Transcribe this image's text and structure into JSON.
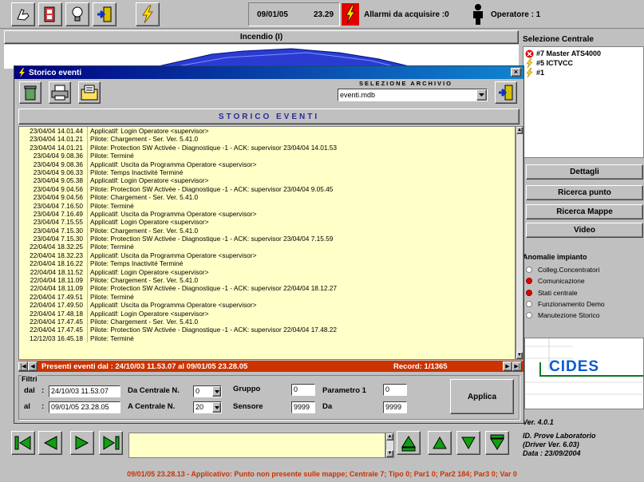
{
  "toolbar": {
    "date": "09/01/05",
    "time": "23.29",
    "alarms": "Allarmi da acquisire :0",
    "operator": "Operatore : 1"
  },
  "alarm_bar": {
    "title": "Incendio (I)"
  },
  "central_panel": {
    "title": "Selezione Centrale",
    "items": [
      {
        "label": "#7 Master ATS4000",
        "icon": "error-x-icon"
      },
      {
        "label": "#5 ICTVCC",
        "icon": "lightning-icon"
      },
      {
        "label": "#1",
        "icon": "lightning-icon"
      }
    ]
  },
  "right_buttons": [
    "Dettagli",
    "Ricerca punto",
    "Ricerca Mappe",
    "Video"
  ],
  "anomalies": {
    "title": "Anomalie impianto",
    "items": [
      {
        "label": "Colleg.Concentratori",
        "active": false
      },
      {
        "label": "Comunicazione",
        "active": true
      },
      {
        "label": "Stati centrale",
        "active": true
      },
      {
        "label": "Funzionamento Demo",
        "active": false
      },
      {
        "label": "Manutezione Storico",
        "active": false
      }
    ]
  },
  "logo": "CIDES",
  "version": {
    "ver": "Ver. 4.0.1",
    "line1": "ID. Prove Laboratorio",
    "line2": "(Driver Ver. 6.03)",
    "line3": "Data : 23/09/2004"
  },
  "dialog": {
    "title": "Storico eventi",
    "archive_label": "SELEZIONE ARCHIVIO",
    "archive_value": "eventi.mdb",
    "header": "STORICO EVENTI",
    "entries": [
      {
        "ts": "23/04/04 14.01.44",
        "msg": "Applicatif:  Login Operatore <supervisor>"
      },
      {
        "ts": "23/04/04 14.01.21",
        "msg": "Pilote: Chargement   - Ser.  Ver. 5.41.0"
      },
      {
        "ts": "23/04/04 14.01.21",
        "msg": "Pilote: Protection SW Activée   - Diagnostique -1 - ACK: supervisor 23/04/04 14.01.53"
      },
      {
        "ts": "23/04/04 9.08.36",
        "msg": "Pilote: Terminé"
      },
      {
        "ts": "23/04/04 9.08.36",
        "msg": "Applicatif:  Uscita da Programma Operatore <supervisor>"
      },
      {
        "ts": "23/04/04 9.06.33",
        "msg": "Pilote: Temps Inactivité Terminé"
      },
      {
        "ts": "23/04/04 9.05.38",
        "msg": "Applicatif:  Login Operatore <supervisor>"
      },
      {
        "ts": "23/04/04 9.04.56",
        "msg": "Pilote: Protection SW Activée   - Diagnostique -1 - ACK: supervisor 23/04/04 9.05.45"
      },
      {
        "ts": "23/04/04 9.04.56",
        "msg": "Pilote: Chargement   - Ser.  Ver. 5.41.0"
      },
      {
        "ts": "23/04/04 7.16.50",
        "msg": "Pilote: Terminé"
      },
      {
        "ts": "23/04/04 7.16.49",
        "msg": "Applicatif:  Uscita da Programma Operatore <supervisor>"
      },
      {
        "ts": "23/04/04 7.15.55",
        "msg": "Applicatif:  Login Operatore <supervisor>"
      },
      {
        "ts": "23/04/04 7.15.30",
        "msg": "Pilote: Chargement   - Ser.  Ver. 5.41.0"
      },
      {
        "ts": "23/04/04 7.15.30",
        "msg": "Pilote: Protection SW Activée   - Diagnostique -1 - ACK: supervisor 23/04/04 7.15.59"
      },
      {
        "ts": "22/04/04 18.32.25",
        "msg": "Pilote: Terminé"
      },
      {
        "ts": "22/04/04 18.32.23",
        "msg": "Applicatif:  Uscita da Programma Operatore <supervisor>"
      },
      {
        "ts": "22/04/04 18.16.22",
        "msg": "Pilote: Temps Inactivité Terminé"
      },
      {
        "ts": "22/04/04 18.11.52",
        "msg": "Applicatif:  Login Operatore <supervisor>"
      },
      {
        "ts": "22/04/04 18.11.09",
        "msg": "Pilote: Chargement   - Ser.  Ver. 5.41.0"
      },
      {
        "ts": "22/04/04 18.11.09",
        "msg": "Pilote: Protection SW Activée   - Diagnostique -1 - ACK: supervisor 22/04/04 18.12.27"
      },
      {
        "ts": "22/04/04 17.49.51",
        "msg": "Pilote: Terminé"
      },
      {
        "ts": "22/04/04 17.49.50",
        "msg": "Applicatif:  Uscita da Programma Operatore <supervisor>"
      },
      {
        "ts": "22/04/04 17.48.18",
        "msg": "Applicatif:  Login Operatore <supervisor>"
      },
      {
        "ts": "22/04/04 17.47.45",
        "msg": "Pilote: Chargement   - Ser.  Ver. 5.41.0"
      },
      {
        "ts": "22/04/04 17.47.45",
        "msg": "Pilote: Protection SW Activée   - Diagnostique -1 - ACK: supervisor 22/04/04 17.48.22"
      },
      {
        "ts": "12/12/03 16.45.18",
        "msg": "Pilote: Terminé"
      }
    ],
    "status_events": "Presenti eventi dal :  24/10/03 11.53.07  al  09/01/05 23.28.05",
    "status_record": "Record: 1/1365",
    "filters": {
      "title": "Filtri",
      "dal_label": "dal",
      "dal_value": "24/10/03 11.53.07",
      "al_label": "al",
      "al_value": "09/01/05 23.28.05",
      "da_centrale_label": "Da Centrale N.",
      "da_centrale_value": "0",
      "a_centrale_label": "A  Centrale N.",
      "a_centrale_value": "20",
      "gruppo_label": "Gruppo",
      "gruppo_value": "0",
      "sensore_label": "Sensore",
      "sensore_value": "9999",
      "parametro_label": "Parametro 1",
      "parametro_value": "0",
      "da_label": "Da",
      "da_value": "9999",
      "apply_label": "Applica"
    }
  },
  "status_message": "09/01/05 23.28.13 - Applicativo:  Punto non presente sulle mappe; Centrale 7; Tipo 0; Par1 0; Par2 184; Par3 0; Var 0",
  "colors": {
    "log_bg": "#ffffc8",
    "status_red": "#cc3300",
    "title_blue": "#000080",
    "header_text": "#2a2a9a"
  }
}
